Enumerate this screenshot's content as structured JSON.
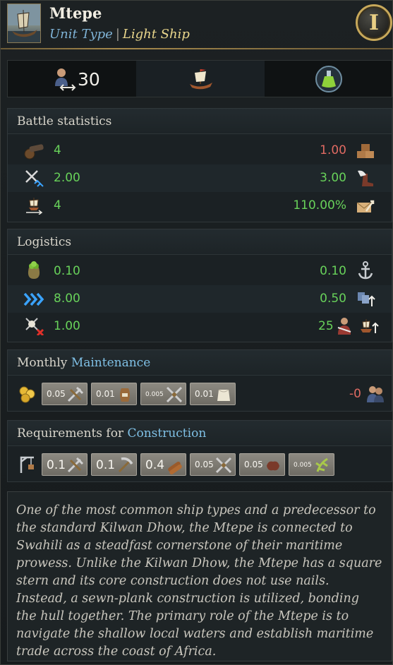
{
  "header": {
    "title": "Mtepe",
    "unit_type_label": "Unit Type",
    "separator": "|",
    "unit_type_value": "Light Ship",
    "badge": "I"
  },
  "summary": {
    "crew": "30",
    "icons": [
      "crew-icon",
      "ship-icon",
      "potion-icon"
    ]
  },
  "battle": {
    "heading": "Battle statistics",
    "rows": [
      {
        "left_icon": "cannon-icon",
        "left": "4",
        "right": "1.00",
        "right_icon": "planks-icon",
        "right_color": "red"
      },
      {
        "left_icon": "crossed-swords-icon",
        "left": "2.00",
        "right": "3.00",
        "right_icon": "winged-boot-icon",
        "right_color": "green"
      },
      {
        "left_icon": "ship-arrows-icon",
        "left": "4",
        "right": "110.00%",
        "right_icon": "envelope-arrow-icon",
        "right_color": "green"
      }
    ]
  },
  "logistics": {
    "heading": "Logistics",
    "rows": [
      {
        "left_icon": "supplies-bag-icon",
        "left": "0.10",
        "right": "0.10",
        "right_icon": "anchor-icon"
      },
      {
        "left_icon": "speed-chevrons-icon",
        "left": "8.00",
        "right": "0.50",
        "right_icon": "troops-up-icon"
      },
      {
        "left_icon": "pirate-swords-icon",
        "left": "1.00",
        "right": "25",
        "right_icon": "soldier-icon",
        "extra_icon": "ship-up-icon"
      }
    ]
  },
  "maintenance": {
    "heading_prefix": "Monthly",
    "heading_highlight": "Maintenance",
    "lead_icon": "gold-coins-icon",
    "chips": [
      {
        "value": "0.05",
        "icon": "hammer-saw-icon"
      },
      {
        "value": "0.01",
        "icon": "barrel-icon"
      },
      {
        "value": "0.005",
        "icon": "crossed-tools-icon"
      },
      {
        "value": "0.01",
        "icon": "cloth-icon"
      }
    ],
    "right_value": "-0",
    "right_icon": "population-icon"
  },
  "construction": {
    "heading_prefix": "Requirements for",
    "heading_highlight": "Construction",
    "lead_icon": "crane-icon",
    "chips": [
      {
        "value": "0.1",
        "icon": "hammer-saw-icon",
        "big": true
      },
      {
        "value": "0.1",
        "icon": "pickaxe-icon",
        "big": true
      },
      {
        "value": "0.4",
        "icon": "logs-icon",
        "big": true
      },
      {
        "value": "0.05",
        "icon": "crossed-tools-icon",
        "big": false
      },
      {
        "value": "0.05",
        "icon": "leather-icon",
        "big": false
      },
      {
        "value": "0.005",
        "icon": "herbs-icon",
        "big": false
      }
    ]
  },
  "description": "One of the most common ship types and a predecessor to the standard Kilwan Dhow, the Mtepe is connected to Swahili as a steadfast cornerstone of their maritime prowess. Unlike the Kilwan Dhow, the Mtepe has a square stern and its core construction does not use nails. Instead, a sewn-plank construction is utilized, bonding the hull together. The primary role of the Mtepe is to navigate the shallow local waters and establish maritime trade across the coast of Africa.",
  "colors": {
    "green": "#68d25a",
    "red": "#e06a62",
    "highlight": "#7fc0e5",
    "gold": "#e9d68c"
  }
}
